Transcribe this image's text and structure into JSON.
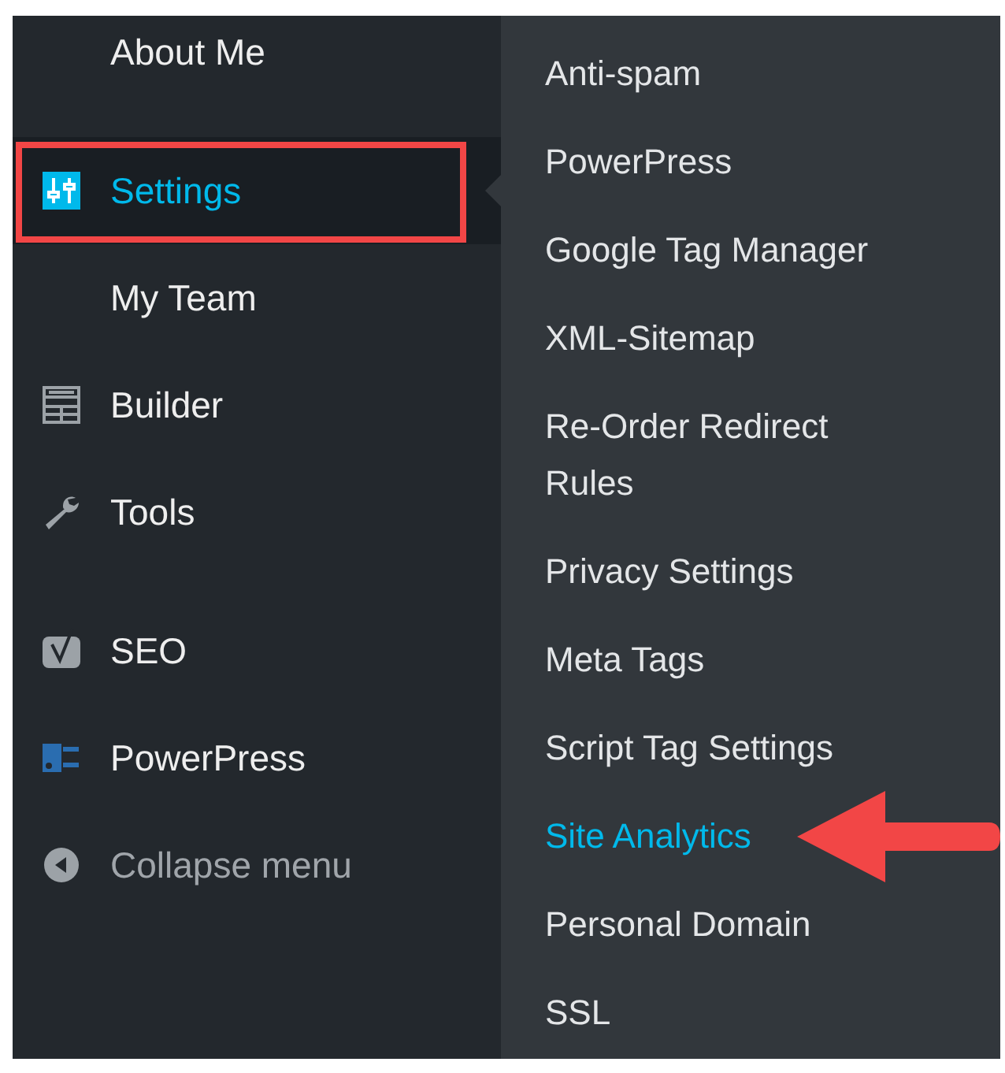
{
  "menu": {
    "items": [
      {
        "label": "About Me",
        "kind": "subitem",
        "selected": false
      },
      {
        "label": "Settings",
        "kind": "settings",
        "selected": true
      },
      {
        "label": "My Team",
        "kind": "subitem",
        "selected": false
      },
      {
        "label": "Builder",
        "kind": "builder",
        "selected": false
      },
      {
        "label": "Tools",
        "kind": "tools",
        "selected": false
      },
      {
        "label": "SEO",
        "kind": "seo",
        "selected": false
      },
      {
        "label": "PowerPress",
        "kind": "powerpress",
        "selected": false
      },
      {
        "label": "Collapse menu",
        "kind": "collapse",
        "selected": false
      }
    ]
  },
  "submenu": {
    "items": [
      {
        "label": "Anti-spam",
        "selected": false
      },
      {
        "label": "PowerPress",
        "selected": false
      },
      {
        "label": "Google Tag Manager",
        "selected": false
      },
      {
        "label": "XML-Sitemap",
        "selected": false
      },
      {
        "label": "Re-Order Redirect Rules",
        "selected": false
      },
      {
        "label": "Privacy Settings",
        "selected": false
      },
      {
        "label": "Meta Tags",
        "selected": false
      },
      {
        "label": "Script Tag Settings",
        "selected": false
      },
      {
        "label": "Site Analytics",
        "selected": true
      },
      {
        "label": "Personal Domain",
        "selected": false
      },
      {
        "label": "SSL",
        "selected": false
      }
    ]
  }
}
